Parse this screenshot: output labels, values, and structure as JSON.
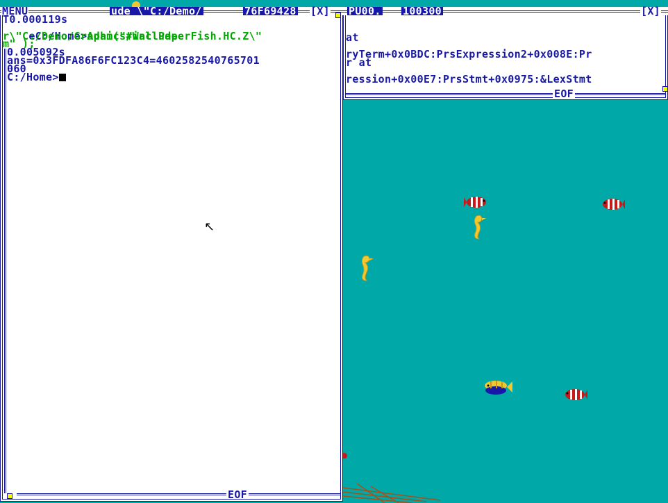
{
  "left_window": {
    "menu_label": "MENU",
    "title_path": "ude \\\"C:/Demo/",
    "title_hash": "76F69428",
    "close_label": "[X]",
    "eof_label": "EOF",
    "lines": [
      "T0.000119s",
      "eC:/Home>",
      "Adam(\"#include",
      "r\\\"C:/Demo/Graphics/WallPaperFish.HC.Z\\\"",
      "m\" );",
      "0.005092s",
      "ans=0x3FDFA86F6FC123C4=4602582540765701",
      "060",
      "C:/Home>"
    ]
  },
  "right_window": {
    "title_left": "PU00.",
    "title_num": "100300",
    "close_label": "[X]",
    "eof_label": "EOF",
    "lines": [
      "at",
      "ryTerm+0x0BDC:PrsExpression2+0x008E:Pr",
      "r at",
      "ression+0x00E7:PrsStmt+0x0975:&LexStmt"
    ]
  },
  "desktop": {
    "background_color": "#00a8a8",
    "fish": [
      "clownfish",
      "clownfish",
      "seahorse",
      "seahorse",
      "angelfish",
      "clownfish"
    ]
  },
  "colors": {
    "border_blue": "#1818a8",
    "text_green": "#00a800",
    "accent_yellow": "#f8f800"
  }
}
